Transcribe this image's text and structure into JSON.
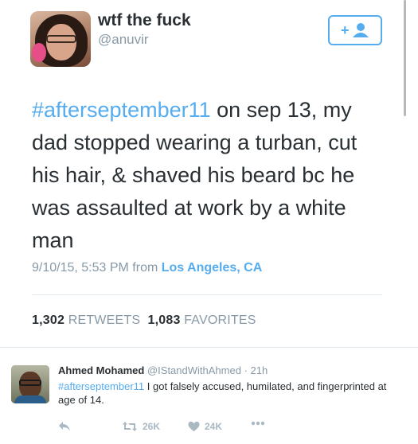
{
  "embedded_tweet": {
    "display_name": "wtf the fuck",
    "handle": "@anuvir",
    "follow_icon": "follow-plus-icon",
    "text_hashtag": "#afterseptember11",
    "text_body": " on sep 13, my dad stopped wearing a turban, cut his hair, & shaved his beard bc he was assaulted at work by a white man",
    "timestamp": "9/10/15, 5:53 PM from ",
    "location": "Los Angeles, CA",
    "retweet_count": "1,302",
    "retweet_label": "RETWEETS",
    "favorite_count": "1,083",
    "favorite_label": "FAVORITES"
  },
  "reply_tweet": {
    "name": "Ahmed Mohamed",
    "handle": "@IStandWithAhmed",
    "separator": "·",
    "time": "21h",
    "hashtag": "#afterseptember11",
    "text": " I got falsely accused, humilated, and fingerprinted at age of 14.",
    "actions": {
      "reply_icon": "reply-arrow-icon",
      "retweet_icon": "retweet-icon",
      "retweet_count": "26K",
      "like_icon": "heart-icon",
      "like_count": "24K",
      "more_icon": "more-dots-icon"
    }
  },
  "colors": {
    "accent": "#55acee",
    "text": "#292f33",
    "muted": "#8899a6",
    "action_gray": "#aab8c2"
  }
}
